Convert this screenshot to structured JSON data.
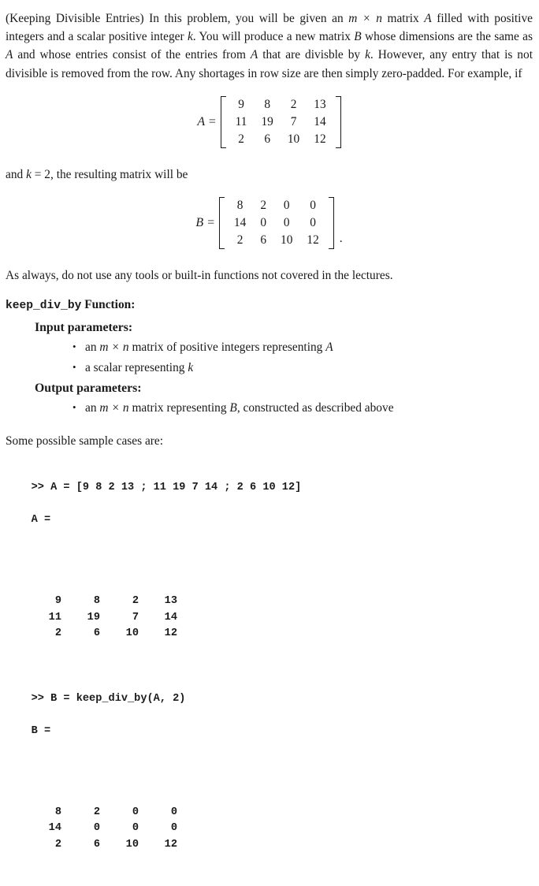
{
  "document": {
    "intro": {
      "title_paren": "(Keeping Divisible Entries)",
      "paragraph_1_html": "(Keeping Divisible Entries) In this problem, you will be given an m × n matrix A filled with positive integers and a scalar positive integer k. You will produce a new matrix B whose dimensions are the same as A and whose entries consist of the entries from A that are divisble by k. However, any entry that is not divisible is removed from the row. Any shortages in row size are then simply zero-padded. For example, if",
      "lead_in_after_A": "and k = 2, the resulting matrix will be",
      "note": "As always, do not use any tools or built-in functions not covered in the lectures.",
      "samples_lead": "Some possible sample cases are:"
    },
    "equations": {
      "A": {
        "lhs": "A =",
        "rows": [
          [
            "9",
            "8",
            "2",
            "13"
          ],
          [
            "11",
            "19",
            "7",
            "14"
          ],
          [
            "2",
            "6",
            "10",
            "12"
          ]
        ],
        "trailing": ""
      },
      "B": {
        "lhs": "B =",
        "rows": [
          [
            "8",
            "2",
            "0",
            "0"
          ],
          [
            "14",
            "0",
            "0",
            "0"
          ],
          [
            "2",
            "6",
            "10",
            "12"
          ]
        ],
        "trailing": "."
      }
    },
    "function_spec": {
      "name": "keep_div_by",
      "heading_suffix": " Function:",
      "input_heading": "Input parameters:",
      "input_items": [
        "an m × n matrix of positive integers representing A",
        "a scalar representing k"
      ],
      "output_heading": "Output parameters:",
      "output_items": [
        "an m × n matrix representing B, constructed as described above"
      ]
    },
    "console": {
      "command_a": ">> A = [9 8 2 13 ; 11 19 7 14 ; 2 6 10 12]",
      "echo_a": "A =",
      "matrix_a": [
        [
          "9",
          "8",
          "2",
          "13"
        ],
        [
          "11",
          "19",
          "7",
          "14"
        ],
        [
          "2",
          "6",
          "10",
          "12"
        ]
      ],
      "command_b": ">> B = keep_div_by(A, 2)",
      "echo_b": "B =",
      "matrix_b": [
        [
          "8",
          "2",
          "0",
          "0"
        ],
        [
          "14",
          "0",
          "0",
          "0"
        ],
        [
          "2",
          "6",
          "10",
          "12"
        ]
      ]
    }
  }
}
